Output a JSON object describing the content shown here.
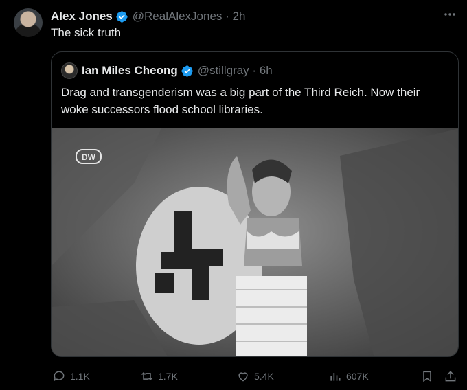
{
  "tweet": {
    "author_name": "Alex Jones",
    "handle_time": "@RealAlexJones · 2h",
    "text": "The sick truth"
  },
  "quote": {
    "author_name": "Ian Miles Cheong",
    "handle_time": "@stillgray · 6h",
    "text": "Drag and transgenderism was a big part of the Third Reich. Now their woke successors flood school libraries.",
    "media": {
      "watermark": "DW"
    }
  },
  "actions": {
    "replies": "1.1K",
    "retweets": "1.7K",
    "likes": "5.4K",
    "views": "607K"
  },
  "colors": {
    "verified": "#1d9bf0",
    "muted": "#71767b",
    "border": "#2f3336"
  }
}
